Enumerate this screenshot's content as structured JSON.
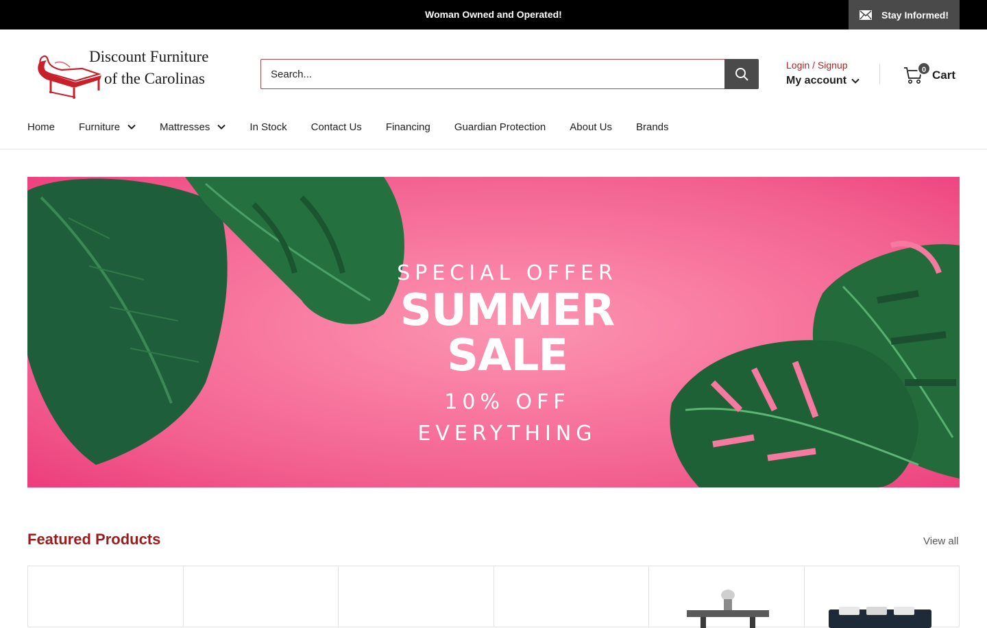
{
  "announcement": {
    "text": "Woman Owned and Operated!",
    "newsletter_label": "Stay Informed!"
  },
  "header": {
    "logo_line1": "Discount Furniture",
    "logo_line2": "of the Carolinas",
    "search_placeholder": "Search...",
    "login_label": "Login / Signup",
    "account_label": "My account",
    "cart_count": "0",
    "cart_label": "Cart"
  },
  "nav": {
    "items": [
      {
        "label": "Home"
      },
      {
        "label": "Furniture"
      },
      {
        "label": "Mattresses"
      },
      {
        "label": "In Stock"
      },
      {
        "label": "Contact Us"
      },
      {
        "label": "Financing"
      },
      {
        "label": "Guardian Protection"
      },
      {
        "label": "About Us"
      },
      {
        "label": "Brands"
      }
    ]
  },
  "hero": {
    "line1": "SPECIAL OFFER",
    "line2": "SUMMER",
    "line3": "SALE",
    "line4": "10% OFF",
    "line5": "EVERYTHING"
  },
  "featured": {
    "title": "Featured Products",
    "view_all": "View all"
  },
  "colors": {
    "brand_red": "#9a1c1c",
    "accent_red": "#b22222",
    "dark_button": "#4a4a4a",
    "hero_pink": "#f97ea3"
  }
}
